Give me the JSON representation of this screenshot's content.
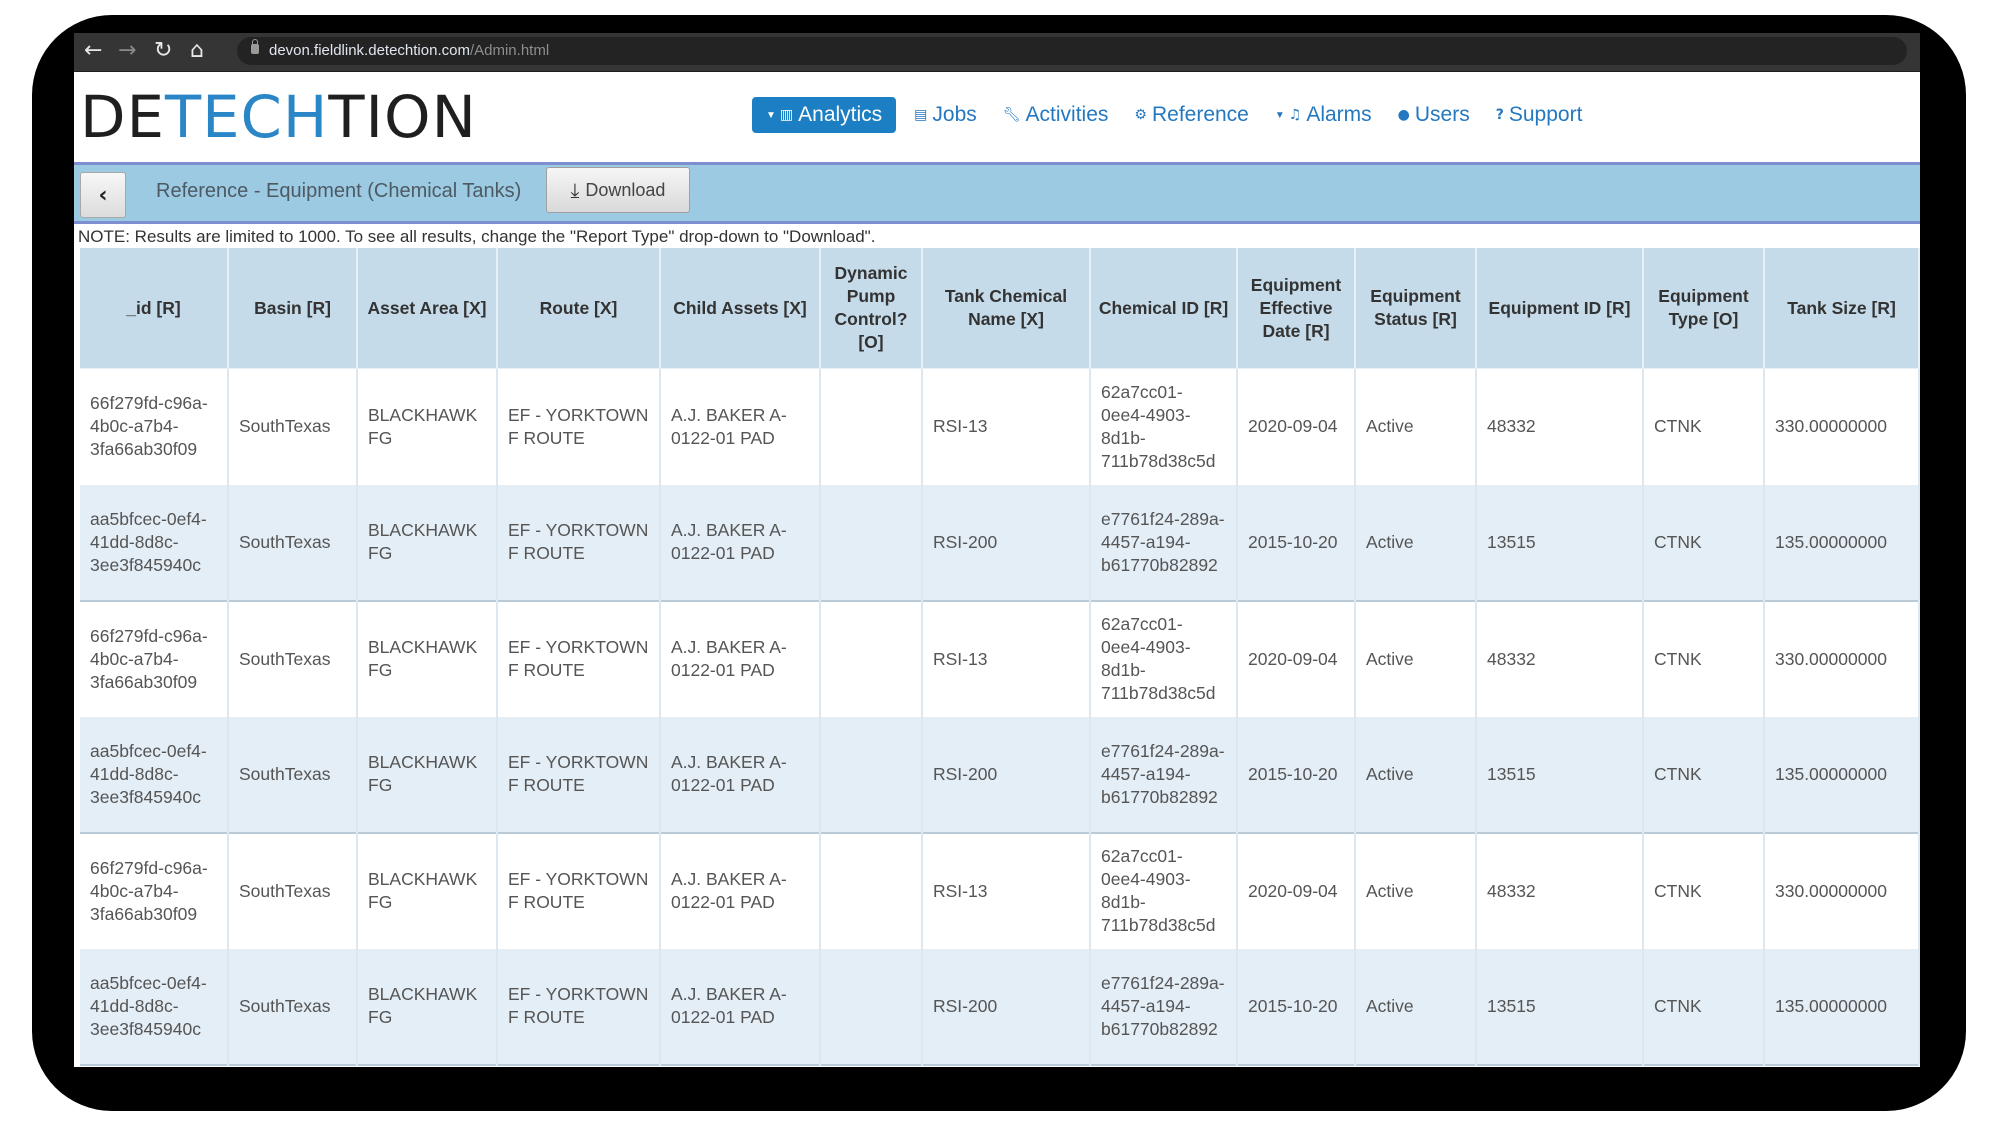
{
  "browser": {
    "back_icon": "arrow-left-icon",
    "forward_icon": "arrow-right-icon",
    "reload_icon": "reload-icon",
    "home_icon": "home-icon",
    "url_host": "devon.fieldlink.detechtion.com",
    "url_path": "/Admin.html"
  },
  "logo": {
    "part1": "DE",
    "part2": "TECH",
    "part3": "TION",
    "accent_color": "#2a86c7"
  },
  "nav": {
    "items": [
      {
        "label": "Analytics",
        "icon": "bar-chart-icon",
        "glyph": "▥",
        "has_caret": true,
        "active": true
      },
      {
        "label": "Jobs",
        "icon": "clipboard-icon",
        "glyph": "▤"
      },
      {
        "label": "Activities",
        "icon": "wrench-icon",
        "glyph": "🔧"
      },
      {
        "label": "Reference",
        "icon": "gear-icon",
        "glyph": "⚙"
      },
      {
        "label": "Alarms",
        "icon": "bell-icon",
        "glyph": "🔔",
        "has_caret": true
      },
      {
        "label": "Users",
        "icon": "user-icon",
        "glyph": "👤"
      },
      {
        "label": "Support",
        "icon": "question-icon",
        "glyph": "?"
      }
    ],
    "active_color": "#1c7fc4"
  },
  "band": {
    "back_glyph": "‹",
    "title": "Reference - Equipment (Chemical Tanks)",
    "download_label": "Download",
    "download_glyph": "⤓"
  },
  "note": "NOTE: Results are limited to 1000. To see all results, change the \"Report Type\" drop-down to \"Download\".",
  "table": {
    "columns": [
      "_id [R]",
      "Basin [R]",
      "Asset Area [X]",
      "Route [X]",
      "Child Assets [X]",
      "Dynamic Pump Control? [O]",
      "Tank Chemical Name [X]",
      "Chemical ID [R]",
      "Equipment Effective Date [R]",
      "Equipment Status [R]",
      "Equipment ID [R]",
      "Equipment Type [O]",
      "Tank Size [R]"
    ],
    "rows": [
      [
        "66f279fd-c96a-4b0c-a7b4-3fa66ab30f09",
        "SouthTexas",
        "BLACKHAWK FG",
        "EF - YORKTOWN F ROUTE",
        "A.J. BAKER A-0122-01 PAD",
        "",
        "RSI-13",
        "62a7cc01-0ee4-4903-8d1b-711b78d38c5d",
        "2020-09-04",
        "Active",
        "48332",
        "CTNK",
        "330.00000000"
      ],
      [
        "aa5bfcec-0ef4-41dd-8d8c-3ee3f845940c",
        "SouthTexas",
        "BLACKHAWK FG",
        "EF - YORKTOWN F ROUTE",
        "A.J. BAKER A-0122-01 PAD",
        "",
        "RSI-200",
        "e7761f24-289a-4457-a194-b61770b82892",
        "2015-10-20",
        "Active",
        "13515",
        "CTNK",
        "135.00000000"
      ],
      [
        "66f279fd-c96a-4b0c-a7b4-3fa66ab30f09",
        "SouthTexas",
        "BLACKHAWK FG",
        "EF - YORKTOWN F ROUTE",
        "A.J. BAKER A-0122-01 PAD",
        "",
        "RSI-13",
        "62a7cc01-0ee4-4903-8d1b-711b78d38c5d",
        "2020-09-04",
        "Active",
        "48332",
        "CTNK",
        "330.00000000"
      ],
      [
        "aa5bfcec-0ef4-41dd-8d8c-3ee3f845940c",
        "SouthTexas",
        "BLACKHAWK FG",
        "EF - YORKTOWN F ROUTE",
        "A.J. BAKER A-0122-01 PAD",
        "",
        "RSI-200",
        "e7761f24-289a-4457-a194-b61770b82892",
        "2015-10-20",
        "Active",
        "13515",
        "CTNK",
        "135.00000000"
      ],
      [
        "66f279fd-c96a-4b0c-a7b4-3fa66ab30f09",
        "SouthTexas",
        "BLACKHAWK FG",
        "EF - YORKTOWN F ROUTE",
        "A.J. BAKER A-0122-01 PAD",
        "",
        "RSI-13",
        "62a7cc01-0ee4-4903-8d1b-711b78d38c5d",
        "2020-09-04",
        "Active",
        "48332",
        "CTNK",
        "330.00000000"
      ],
      [
        "aa5bfcec-0ef4-41dd-8d8c-3ee3f845940c",
        "SouthTexas",
        "BLACKHAWK FG",
        "EF - YORKTOWN F ROUTE",
        "A.J. BAKER A-0122-01 PAD",
        "",
        "RSI-200",
        "e7761f24-289a-4457-a194-b61770b82892",
        "2015-10-20",
        "Active",
        "13515",
        "CTNK",
        "135.00000000"
      ]
    ]
  }
}
